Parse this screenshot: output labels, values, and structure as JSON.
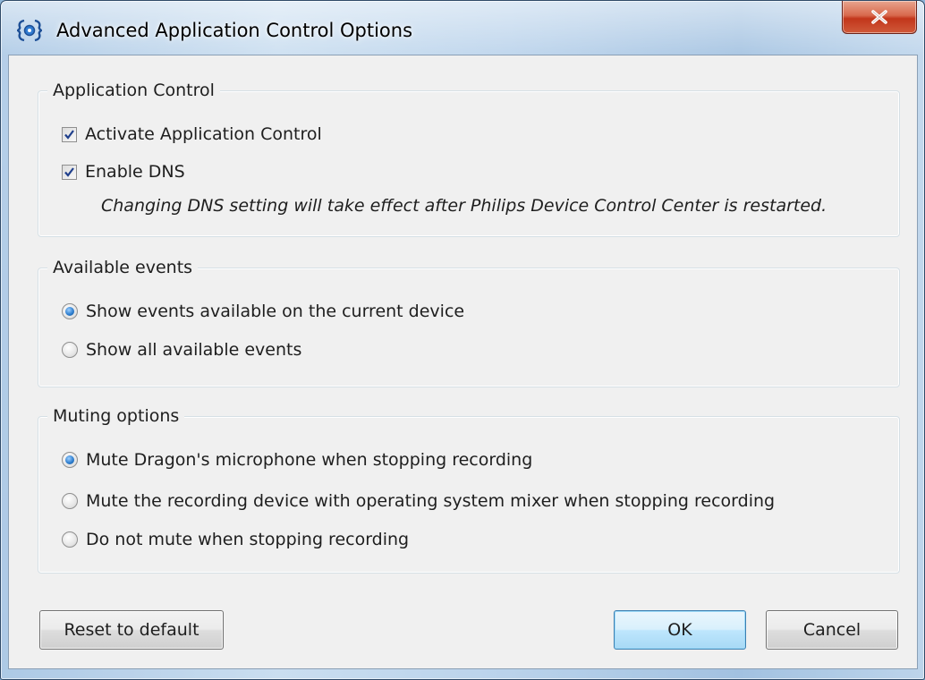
{
  "window": {
    "title": "Advanced Application Control Options",
    "app_icon": "philips-device-control-icon",
    "close_icon": "close-icon"
  },
  "application_control": {
    "title": "Application Control",
    "activate": {
      "label": "Activate Application Control",
      "checked": true
    },
    "enable_dns": {
      "label": "Enable DNS",
      "checked": true
    },
    "note": "Changing DNS setting will take effect after Philips Device Control Center is restarted."
  },
  "available_events": {
    "title": "Available events",
    "options": [
      {
        "label": "Show events available on the current device",
        "selected": true
      },
      {
        "label": "Show all available events",
        "selected": false
      }
    ]
  },
  "muting_options": {
    "title": "Muting options",
    "options": [
      {
        "label": "Mute Dragon's microphone when stopping recording",
        "selected": true
      },
      {
        "label": "Mute the recording device with operating system mixer when stopping recording",
        "selected": false
      },
      {
        "label": "Do not mute when stopping recording",
        "selected": false
      }
    ]
  },
  "buttons": {
    "reset": "Reset to default",
    "ok": "OK",
    "cancel": "Cancel"
  },
  "colors": {
    "dialog_background": "#f0f0f0",
    "close_button": "#c2361b",
    "default_button_border": "#3c7fb1"
  }
}
